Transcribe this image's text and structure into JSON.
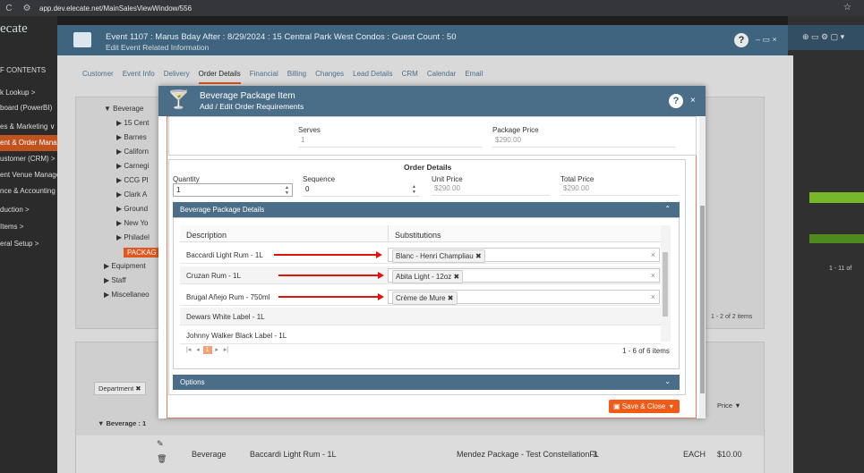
{
  "browser": {
    "url": "app.dev.elecate.net/MainSalesViewWindow/556"
  },
  "app": {
    "logo": "ecate",
    "nav": [
      {
        "label": "F CONTENTS"
      },
      {
        "label": "k Lookup  >"
      },
      {
        "label": "board (PowerBI)"
      },
      {
        "label": "es & Marketing  ∨"
      },
      {
        "label": "ent & Order Mana"
      },
      {
        "label": "ustomer (CRM)  >"
      },
      {
        "label": "ent Venue Manage"
      },
      {
        "label": "nce & Accounting"
      },
      {
        "label": "duction  >"
      },
      {
        "label": "Items  >"
      },
      {
        "label": "eral Setup  >"
      }
    ]
  },
  "event": {
    "title": "Event 1107 : Marus Bday After : 8/29/2024 : 15 Central Park West Condos : Guest Count : 50",
    "subtitle": "Edit Event Related Information",
    "tabs": [
      "Customer",
      "Event Info",
      "Delivery",
      "Order Details",
      "Financial",
      "Billing",
      "Changes",
      "Lead Details",
      "CRM",
      "Calendar",
      "Email"
    ],
    "active_tab": "Order Details",
    "tree": [
      "▼  Beverage",
      "▶  15 Cent",
      "▶  Barnes",
      "▶  Californ",
      "▶  Carnegi",
      "▶  CCG Pl",
      "▶  Clark A",
      "▶  Ground",
      "▶  New Yo",
      "▶  Philadel",
      "PACKAG",
      "▶  Equipment",
      "▶  Staff",
      "▶  Miscellaneo"
    ],
    "right_count": "1 - 2 of 2 items",
    "far_right_count": "1 - 11 of",
    "lower": {
      "dept_chip": "Department",
      "group_row": "▼  Beverage : 1",
      "price_header": "Price",
      "row": {
        "category": "Beverage",
        "item": "Baccardi Light Rum - 1L",
        "package": "Mendez Package - Test ConstellationFL",
        "qty": "3",
        "unit": "EACH",
        "price": "$10.00"
      }
    }
  },
  "modal": {
    "title": "Beverage Package Item",
    "subtitle": "Add / Edit Order Requirements",
    "serves_label": "Serves",
    "serves_value": "1",
    "package_price_label": "Package Price",
    "package_price_value": "$290.00",
    "order_details_label": "Order Details",
    "quantity_label": "Quantity",
    "quantity_value": "1",
    "sequence_label": "Sequence",
    "sequence_value": "0",
    "unit_price_label": "Unit Price",
    "unit_price_value": "$290.00",
    "total_price_label": "Total Price",
    "total_price_value": "$290.00",
    "details_header": "Beverage Package Details",
    "col_description": "Description",
    "col_substitutions": "Substitutions",
    "rows": [
      {
        "description": "Baccardi Light Rum - 1L",
        "substitution": "Blanc - Henri Champliau"
      },
      {
        "description": "Cruzan Rum - 1L",
        "substitution": "Abita Light - 12oz"
      },
      {
        "description": "Brugal Añejo Rum - 750ml",
        "substitution": "Crème de Mure"
      },
      {
        "description": "Dewars White Label - 1L",
        "substitution": ""
      },
      {
        "description": "Johnny Walker Black Label - 1L",
        "substitution": ""
      }
    ],
    "pager_page": "1",
    "pager_info": "1 - 6 of 6 items",
    "options_header": "Options",
    "save_label": "Save & Close"
  },
  "colors": {
    "header": "#4a6e88",
    "accent": "#f05b18",
    "arrow": "#e3120b"
  }
}
